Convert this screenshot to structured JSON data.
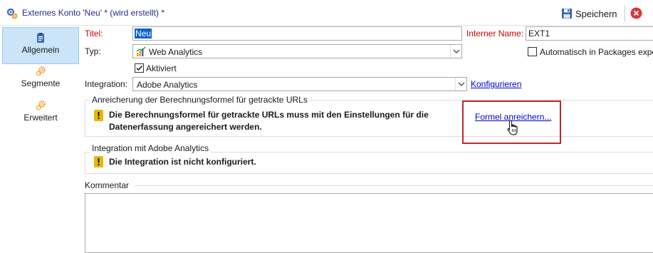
{
  "window": {
    "title": "Externes Konto 'Neu' * (wird erstellt) *",
    "icon": "gear-globe-icon"
  },
  "toolbar": {
    "save_label": "Speichern",
    "save_icon": "floppy-disk-icon",
    "cancel_icon": "close-circle-icon"
  },
  "nav": {
    "items": [
      {
        "label": "Allgemein",
        "icon": "clipboard-icon",
        "active": true
      },
      {
        "label": "Segmente",
        "icon": "gears-icon",
        "active": false
      },
      {
        "label": "Erweitert",
        "icon": "gears-icon",
        "active": false
      }
    ]
  },
  "form": {
    "title_label": "Titel:",
    "title_value": "Neu",
    "internal_name_label": "Interner Name:",
    "internal_name_value": "EXT1",
    "type_label": "Typ:",
    "type_value": "Web Analytics",
    "type_icon": "bar-chart-icon",
    "auto_export_label": "Automatisch in Packages expo",
    "auto_export_checked": false,
    "activated_label": "Aktiviert",
    "activated_checked": true,
    "integration_label": "Integration:",
    "integration_value": "Adobe Analytics",
    "configure_link": "Konfigurieren"
  },
  "enrichment_group": {
    "title": "Anreicherung der Berechnungsformel für getrackte URLs",
    "warning_line1": "Die Berechnungsformel für getrackte URLs muss mit den Einstellungen für die",
    "warning_line2": "Datenerfassung angereichert werden.",
    "enrich_link": "Formel anreichern..."
  },
  "integration_group": {
    "title": "Integration mit Adobe Analytics",
    "warning": "Die Integration ist nicht konfiguriert."
  },
  "comment": {
    "label": "Kommentar",
    "value": ""
  },
  "colors": {
    "accent_highlight": "#c0282c",
    "selection": "#0a64c8",
    "nav_active": "#cce4f7",
    "link": "#0000cc",
    "required_label": "#cc0000",
    "warning_icon": "#e6b800"
  }
}
